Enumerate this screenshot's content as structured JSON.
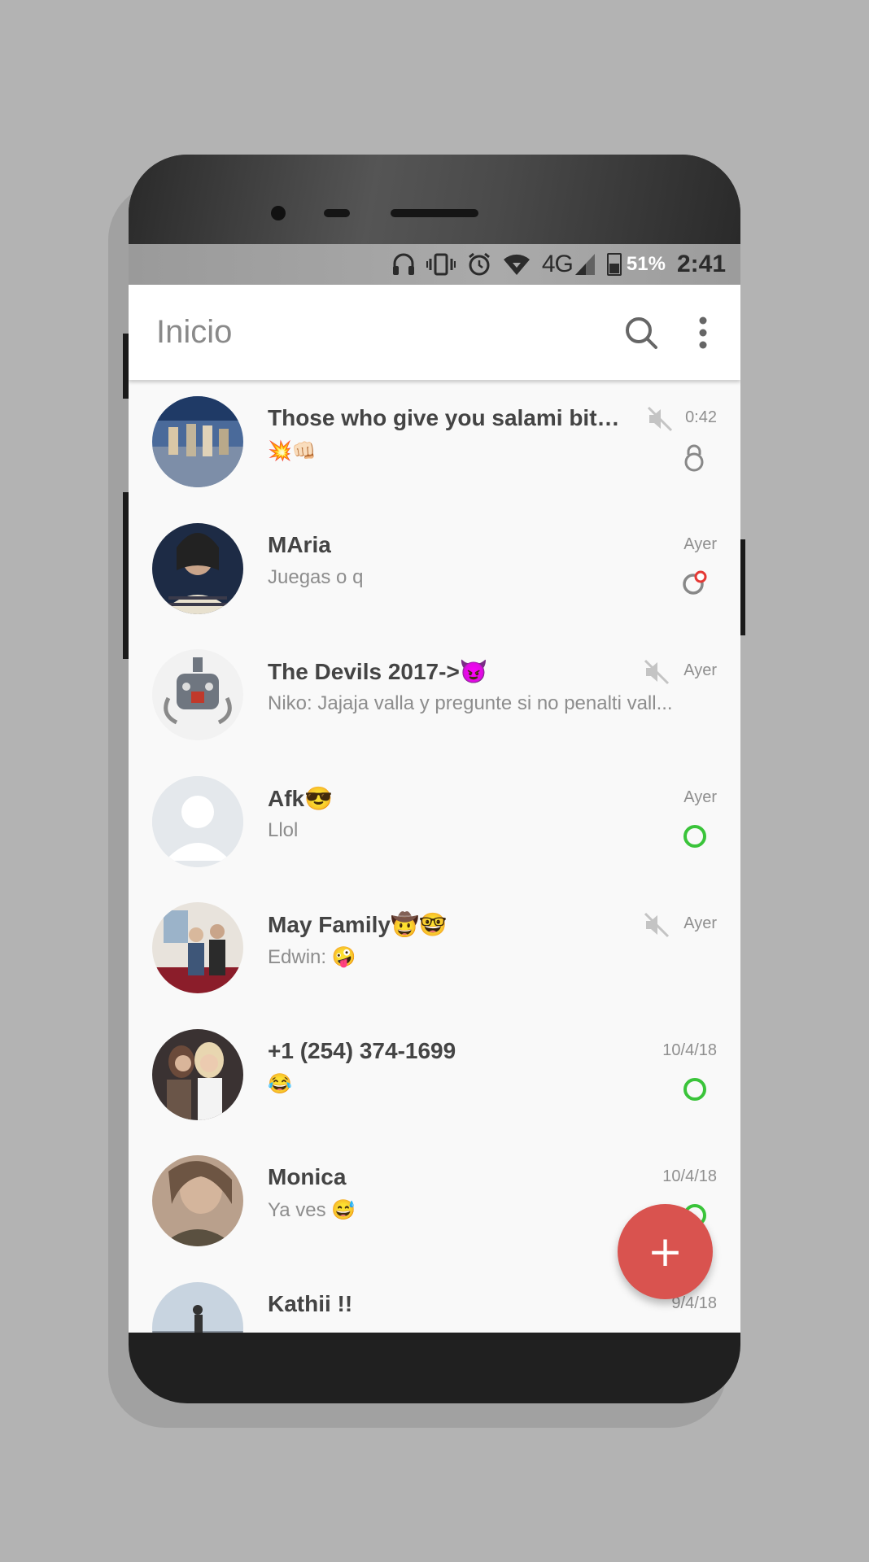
{
  "status_bar": {
    "network": "4G",
    "battery": "51%",
    "battery_level": 0.51,
    "time": "2:41"
  },
  "app_bar": {
    "title": "Inicio",
    "search_icon": "search-icon",
    "menu_icon": "more-vert-icon"
  },
  "chats": [
    {
      "name": "Those who give you salami bitc...",
      "message": "💥👊🏻",
      "time": "0:42",
      "muted": true,
      "indicator": "lock"
    },
    {
      "name": "MAria",
      "message": "Juegas o q",
      "time": "Ayer",
      "muted": false,
      "indicator": "status-new"
    },
    {
      "name": "The Devils 2017->😈",
      "message": "Niko: Jajaja valla y pregunte si no penalti vall...",
      "time": "Ayer",
      "muted": true,
      "indicator": "none"
    },
    {
      "name": "Afk😎",
      "message": "Llol",
      "time": "Ayer",
      "muted": false,
      "indicator": "status-ring"
    },
    {
      "name": "May Family🤠🤓",
      "message": "Edwin: 🤪",
      "time": "Ayer",
      "muted": true,
      "indicator": "none"
    },
    {
      "name": "+1 (254) 374-1699",
      "message": "😂",
      "time": "10/4/18",
      "muted": false,
      "indicator": "status-ring"
    },
    {
      "name": "Monica",
      "message": "Ya ves 😅",
      "time": "10/4/18",
      "muted": false,
      "indicator": "status-ring"
    },
    {
      "name": "Kathii !!",
      "message": "",
      "time": "9/4/18",
      "muted": false,
      "indicator": "none"
    }
  ],
  "fab": {
    "label": "+"
  },
  "colors": {
    "accent": "#d9534f",
    "status_green": "#3ac43a",
    "status_red": "#e53935"
  }
}
